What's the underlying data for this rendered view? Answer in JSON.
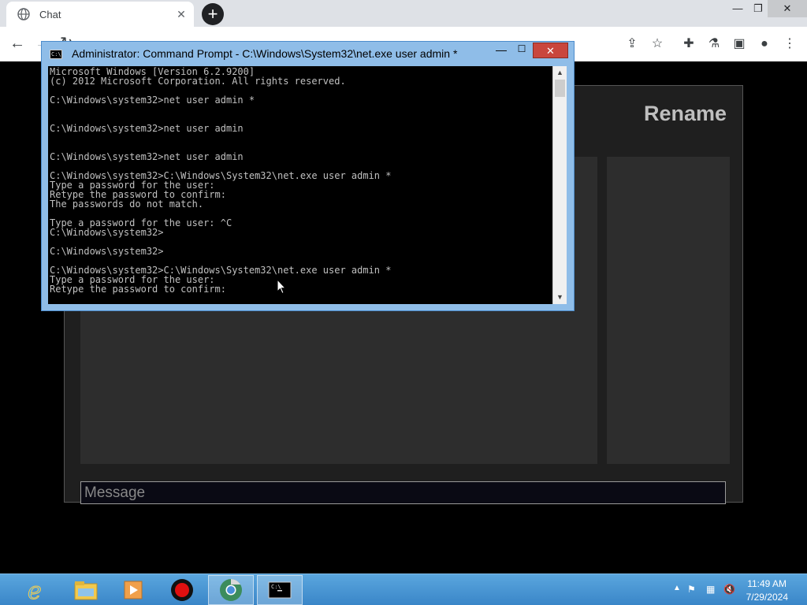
{
  "browser": {
    "tab_title": "Chat",
    "tab_close": "✕",
    "new_tab": "+"
  },
  "page": {
    "rename_label": "Rename",
    "message_placeholder": "Message"
  },
  "cmd": {
    "title": "Administrator: Command Prompt - C:\\Windows\\System32\\net.exe  user admin *",
    "lines": [
      "Microsoft Windows [Version 6.2.9200]",
      "(c) 2012 Microsoft Corporation. All rights reserved.",
      "",
      "C:\\Windows\\system32>net user admin *",
      "",
      "",
      "C:\\Windows\\system32>net user admin",
      "",
      "",
      "C:\\Windows\\system32>net user admin",
      "",
      "C:\\Windows\\system32>C:\\Windows\\System32\\net.exe user admin *",
      "Type a password for the user:",
      "Retype the password to confirm:",
      "The passwords do not match.",
      "",
      "Type a password for the user: ^C",
      "C:\\Windows\\system32>",
      "",
      "C:\\Windows\\system32>",
      "",
      "C:\\Windows\\system32>C:\\Windows\\System32\\net.exe user admin *",
      "Type a password for the user:",
      "Retype the password to confirm:"
    ]
  },
  "taskbar": {
    "time": "11:49 AM",
    "date": "7/29/2024"
  }
}
